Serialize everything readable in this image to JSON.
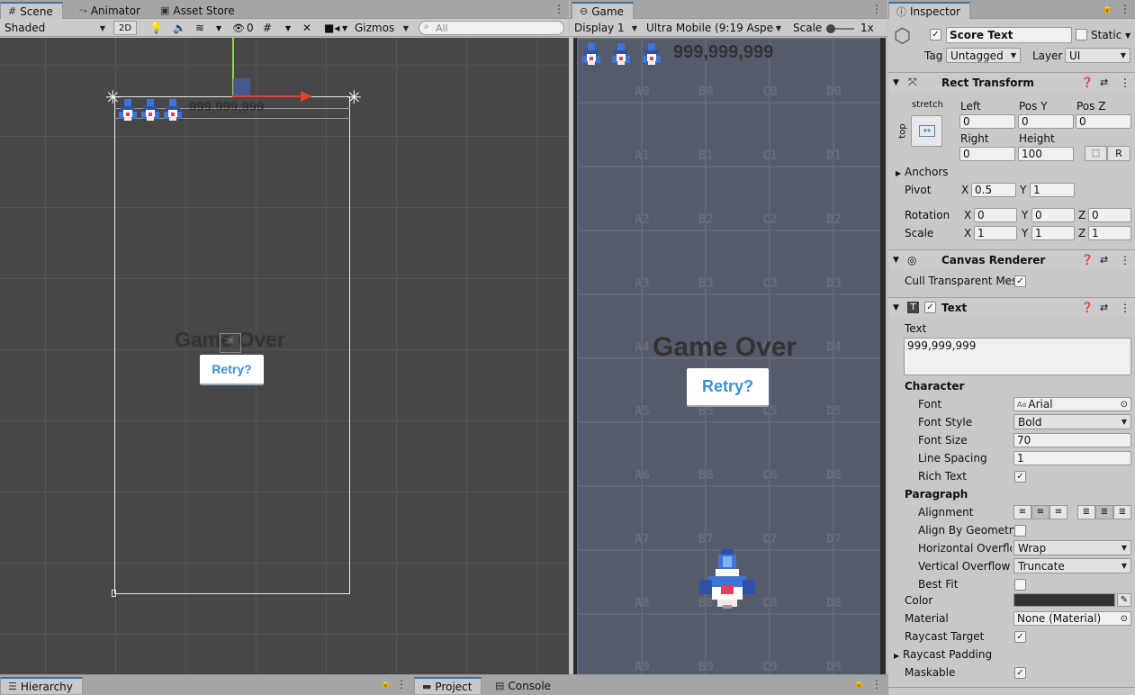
{
  "scene_panel": {
    "tabs": [
      "Scene",
      "Animator",
      "Asset Store"
    ],
    "shading_mode": "Shaded",
    "btn_2d": "2D",
    "hidden_count": "0",
    "gizmos": "Gizmos",
    "search_placeholder": "All",
    "score_text": "999,999,999",
    "game_over": "Game Over",
    "retry": "Retry?"
  },
  "game_panel": {
    "tab": "Game",
    "display": "Display 1",
    "aspect": "Ultra Mobile (9:19 Aspect)",
    "scale_label": "Scale",
    "scale_value": "1x",
    "score_text": "999,999,999",
    "game_over": "Game Over",
    "retry": "Retry?",
    "grid_labels": [
      [
        "A0",
        "B0",
        "C0",
        "D0"
      ],
      [
        "A1",
        "B1",
        "C1",
        "D1"
      ],
      [
        "A2",
        "B2",
        "C2",
        "D2"
      ],
      [
        "A3",
        "B3",
        "C3",
        "D3"
      ],
      [
        "A4",
        "B4",
        "C4",
        "D4"
      ],
      [
        "A5",
        "B5",
        "C5",
        "D5"
      ],
      [
        "A6",
        "B6",
        "C6",
        "D6"
      ],
      [
        "A7",
        "B7",
        "C7",
        "D7"
      ],
      [
        "A8",
        "B8",
        "C8",
        "D8"
      ],
      [
        "A9",
        "B9",
        "C9",
        "D9"
      ]
    ]
  },
  "bottom": {
    "hierarchy": "Hierarchy",
    "project": "Project",
    "console": "Console"
  },
  "inspector": {
    "tab": "Inspector",
    "object_name": "Score Text",
    "static_label": "Static",
    "tag_label": "Tag",
    "tag_value": "Untagged",
    "layer_label": "Layer",
    "layer_value": "UI",
    "rect_transform": {
      "title": "Rect Transform",
      "anchor_h": "stretch",
      "anchor_v": "top",
      "left_label": "Left",
      "left": "0",
      "posy_label": "Pos Y",
      "posy": "0",
      "posz_label": "Pos Z",
      "posz": "0",
      "right_label": "Right",
      "right": "0",
      "height_label": "Height",
      "height": "100",
      "r_btn": "R",
      "anchors": "Anchors",
      "pivot_label": "Pivot",
      "pivot_x": "0.5",
      "pivot_y": "1",
      "rotation_label": "Rotation",
      "rot_x": "0",
      "rot_y": "0",
      "rot_z": "0",
      "scale_label": "Scale",
      "scale_x": "1",
      "scale_y": "1",
      "scale_z": "1"
    },
    "canvas_renderer": {
      "title": "Canvas Renderer",
      "cull_label": "Cull Transparent Mes"
    },
    "text": {
      "title": "Text",
      "text_label": "Text",
      "text_value": "999,999,999",
      "character": "Character",
      "font_label": "Font",
      "font_value": "Arial",
      "font_style_label": "Font Style",
      "font_style_value": "Bold",
      "font_size_label": "Font Size",
      "font_size_value": "70",
      "line_spacing_label": "Line Spacing",
      "line_spacing_value": "1",
      "rich_text_label": "Rich Text",
      "paragraph": "Paragraph",
      "alignment_label": "Alignment",
      "align_geom_label": "Align By Geometry",
      "h_overflow_label": "Horizontal Overflow",
      "h_overflow_value": "Wrap",
      "v_overflow_label": "Vertical Overflow",
      "v_overflow_value": "Truncate",
      "best_fit_label": "Best Fit",
      "color_label": "Color",
      "color_value": "#323232",
      "material_label": "Material",
      "material_value": "None (Material)",
      "raycast_target_label": "Raycast Target",
      "raycast_padding_label": "Raycast Padding",
      "maskable_label": "Maskable"
    }
  }
}
